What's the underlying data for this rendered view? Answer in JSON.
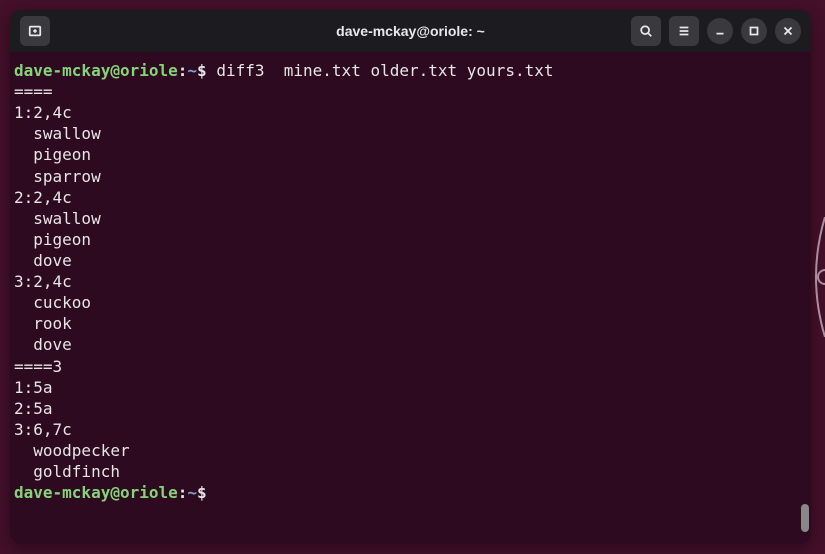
{
  "titlebar": {
    "title": "dave-mckay@oriole: ~"
  },
  "prompt": {
    "user_host": "dave-mckay@oriole",
    "colon": ":",
    "path": "~",
    "dollar": "$"
  },
  "session": {
    "cmd1": "diff3  mine.txt older.txt yours.txt",
    "output": [
      "====",
      "1:2,4c",
      "  swallow",
      "  pigeon",
      "  sparrow",
      "2:2,4c",
      "  swallow",
      "  pigeon",
      "  dove",
      "3:2,4c",
      "  cuckoo",
      "  rook",
      "  dove",
      "====3",
      "1:5a",
      "2:5a",
      "3:6,7c",
      "  woodpecker",
      "  goldfinch"
    ]
  }
}
